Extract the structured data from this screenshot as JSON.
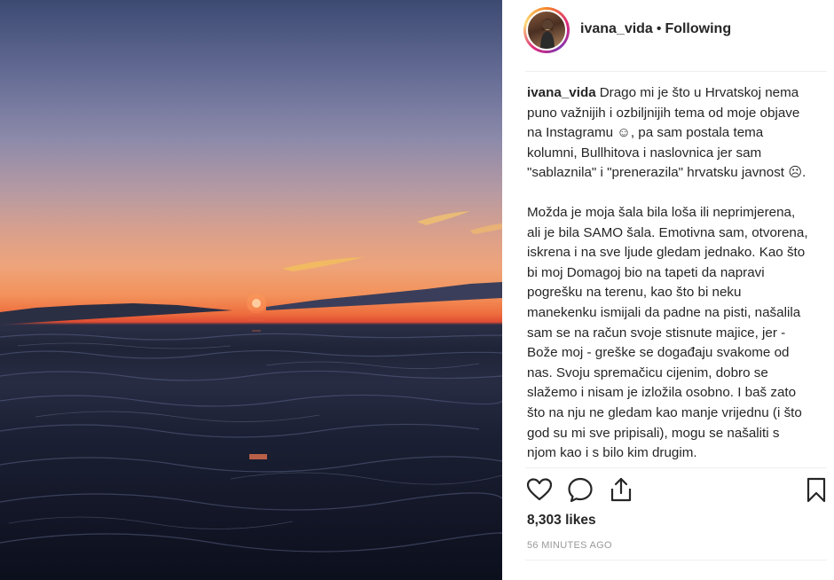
{
  "photo": {
    "description_icon": "sunset-photo"
  },
  "header": {
    "username": "ivana_vida",
    "separator": "•",
    "follow_status": "Following"
  },
  "caption": {
    "username": "ivana_vida",
    "paragraph1": "Drago mi je što u Hrvatskoj nema puno važnijih i ozbiljnijih tema od moje objave na Instagramu ☺, pa sam postala tema kolumni, Bullhitova i naslovnica jer sam \"sablaznila\" i \"prenerazila\" hrvatsku javnost ☹.",
    "paragraph2": "Možda je moja šala bila loša ili neprimjerena, ali je bila SAMO šala. Emotivna sam, otvorena, iskrena i na sve ljude gledam jednako. Kao što bi moj Domagoj bio na tapeti da napravi pogrešku na terenu, kao što bi neku manekenku ismijali da padne na pisti, našalila sam se na račun svoje stisnute majice, jer - Bože moj - greške se događaju svakome od nas. Svoju spremačicu cijenim, dobro se slažemo i nisam je izložila osobno. I baš zato što na nju ne gledam kao manje vrijednu (i što god su mi sve pripisali), mogu se našaliti s njom kao i s bilo kim drugim."
  },
  "actions": {
    "like_icon": "heart-icon",
    "comment_icon": "comment-icon",
    "share_icon": "share-icon",
    "save_icon": "bookmark-icon"
  },
  "stats": {
    "likes": "8,303 likes",
    "time": "56 MINUTES AGO"
  }
}
